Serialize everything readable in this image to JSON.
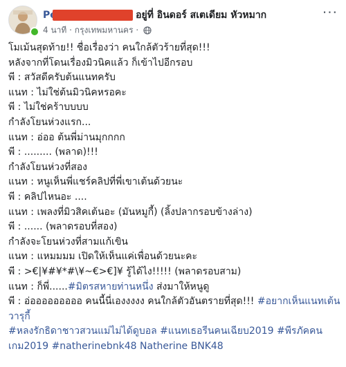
{
  "author": {
    "name": "Perapat Rattana",
    "location_text": "อยู่ที่ อินดอร์ สเตเดียม หัวหมาก"
  },
  "meta": {
    "time": "4 นาที",
    "dot": "·",
    "place": "กรุงเทพมหานคร",
    "dot2": "·",
    "privacy_icon": "globe-icon"
  },
  "post": {
    "lines": [
      "โมเม้นสุดท้าย!! ชื่อเรื่องว่า คนใกล้ตัวร้ายที่สุด!!!",
      "หลังจากที่โดนเรื่องมิวนิคแล้ว ก็เข้าไปอีกรอบ",
      "พี : สวัสดีครับต้นแนทครับ",
      "แนท : ไม่ใช่ต้นมิวนิคหรอคะ",
      "พี : ไม่ใช่คร้าบบบบ",
      "กำลังโยนห่วงแรก...",
      "แนท : อ่ออ ต้นพี่ม่านมุกกกก",
      "พี : ......... (พลาด)!!!",
      "กำลังโยนห่วงที่สอง",
      "แนท : หนูเห็นพี่แชร์คลิปที่พี่เขาเต้นด้วยนะ",
      "พี : คลิปไหนอะ ....",
      "แนท : เพลงที่มิวสิคเต้นอะ (มันหมูกี้) (ลิ้งปลากรอบข้างล่าง)",
      "พี : ...... (พลาดรอบที่สอง)",
      "กำลังจะโยนห่วงที่สามแก้เขิน",
      "แนท : แหมมมม เปิดให้เห็นแค่เพื่อนด้วยนะคะ",
      "พี : >€|¥#¥*#\\¥~€>€]¥ รู้ได้ไง!!!!! (พลาดรอบสาม)"
    ],
    "line_p17_prefix": "แนท : ก็พี่......",
    "line_p17_tag": "#มิตรสหายท่านหนึ่ง",
    "line_p17_suffix": " ส่งมาให้หนูดู",
    "line_p18_text": "พี : อ่อออออออออ คนนี้นี่เองงงงง คนใกล้ตัวอันตรายที่สุด!!! ",
    "line_p18_tag": "#อยากเห็นแนทเต้นวารุกี้",
    "hashtags": [
      "#หลงรักธิดาชาวสวนแม่ไม่ได้ดูบอล",
      "#แนทเธอรีนคนเฉียบ2019",
      "#พีรภัคคนเกม2019",
      "#natherinebnk48",
      "Natherine",
      "BNK48"
    ]
  },
  "colors": {
    "link": "#385898",
    "text": "#1c1e21",
    "meta": "#616770",
    "online": "#42b72a"
  }
}
